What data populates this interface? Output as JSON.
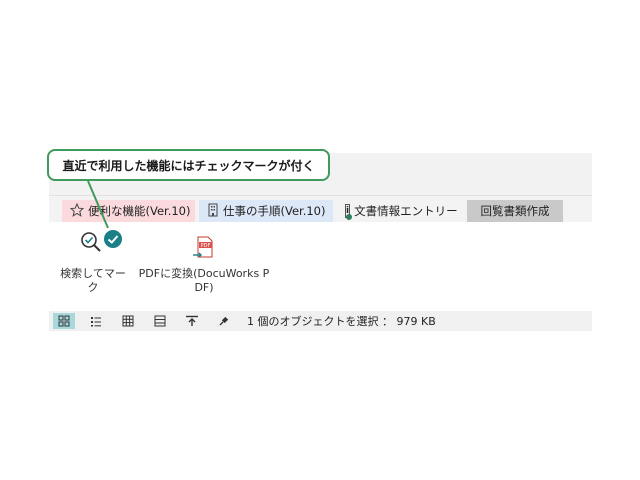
{
  "callout": {
    "text": "直近で利用した機能にはチェックマークが付く"
  },
  "tabs": [
    {
      "label": "便利な機能(Ver.10)",
      "icon": "star-icon",
      "color": "#fadadd"
    },
    {
      "label": "仕事の手順(Ver.10)",
      "icon": "building-icon",
      "color": "#dce7f7"
    },
    {
      "label": "文書情報エントリー",
      "icon": "document-info-icon"
    },
    {
      "label": "回覧書類作成",
      "active": true,
      "color": "#c9c9c9"
    }
  ],
  "commands": [
    {
      "label": "検索してマーク",
      "icon": "search-mark-icon",
      "recently_used": true
    },
    {
      "label_line1": "PDFに変換(DocuWorks P",
      "label_line2": "DF)",
      "icon": "pdf-convert-icon"
    }
  ],
  "statusbar": {
    "view_buttons": [
      "grid-view-icon",
      "list-view-icon",
      "table-view-icon",
      "detail-view-icon",
      "upload-icon",
      "pin-icon"
    ],
    "active_view": "grid-view-icon",
    "text": "1 個のオブジェクトを選択 ： 979 KB"
  },
  "colors": {
    "callout_border": "#3f9a5b",
    "check_badge": "#1a7f86",
    "active_view": "#a8d8dc"
  }
}
